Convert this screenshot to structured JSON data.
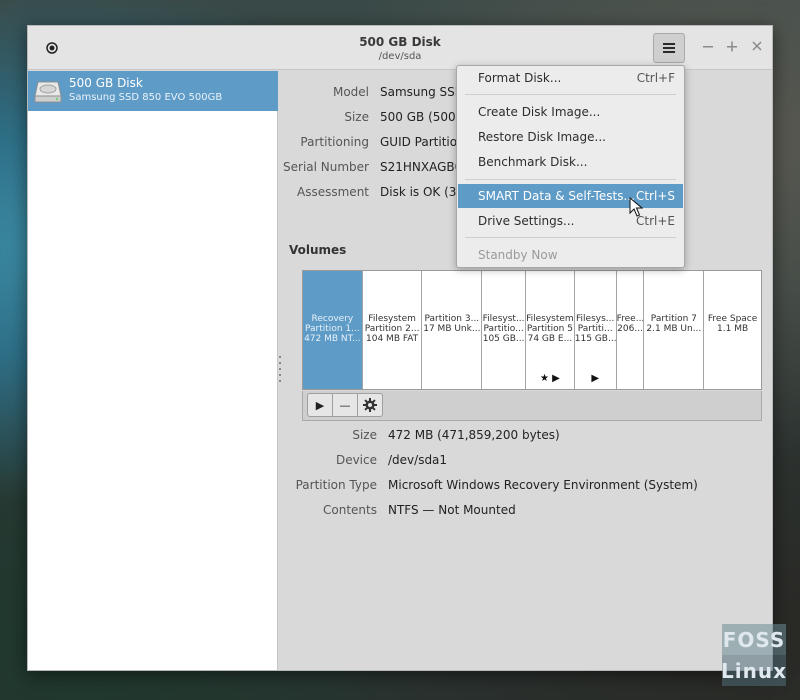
{
  "window": {
    "title": "500 GB Disk",
    "subtitle": "/dev/sda"
  },
  "sidebar": {
    "disk_name": "500 GB Disk",
    "disk_model": "Samsung SSD 850 EVO 500GB"
  },
  "drive": {
    "labels": [
      "Model",
      "Size",
      "Partitioning",
      "Serial Number",
      "Assessment"
    ],
    "values": [
      "Samsung SSD",
      "500 GB (500,1",
      "GUID Partition",
      "S21HNXAGB0",
      "Disk is OK (32"
    ]
  },
  "volumes": {
    "title": "Volumes",
    "segments": [
      {
        "line1": "Recovery",
        "line2": "Partition 1...",
        "line3": "472 MB NT...",
        "marks": ""
      },
      {
        "line1": "Filesystem",
        "line2": "Partition 2...",
        "line3": "104 MB FAT",
        "marks": ""
      },
      {
        "line1": "Partition 3...",
        "line2": "17 MB Unk...",
        "line3": "",
        "marks": ""
      },
      {
        "line1": "Filesyst...",
        "line2": "Partitio...",
        "line3": "105 GB...",
        "marks": ""
      },
      {
        "line1": "Filesystem",
        "line2": "Partition 5",
        "line3": "74 GB E...",
        "marks": "★ ▶"
      },
      {
        "line1": "Filesys...",
        "line2": "Partiti...",
        "line3": "115 GB...",
        "marks": "▶"
      },
      {
        "line1": "Free...",
        "line2": "206...",
        "line3": "",
        "marks": ""
      },
      {
        "line1": "Partition 7",
        "line2": "2.1 MB Un...",
        "line3": "",
        "marks": ""
      },
      {
        "line1": "Free Space",
        "line2": "1.1 MB",
        "line3": "",
        "marks": ""
      }
    ],
    "selected_index": 0
  },
  "toolbar": {
    "play_icon": "▶",
    "minus_icon": "—",
    "gear_icon": "gear"
  },
  "details": {
    "size_label": "Size",
    "size_value": "472 MB (471,859,200 bytes)",
    "device_label": "Device",
    "device_value": "/dev/sda1",
    "ptype_label": "Partition Type",
    "ptype_value": "Microsoft Windows Recovery Environment (System)",
    "contents_label": "Contents",
    "contents_value": "NTFS — Not Mounted"
  },
  "menu": {
    "items": [
      {
        "label": "Format Disk...",
        "accel": "Ctrl+F"
      },
      {
        "label": "Create Disk Image...",
        "accel": ""
      },
      {
        "label": "Restore Disk Image...",
        "accel": ""
      },
      {
        "label": "Benchmark Disk...",
        "accel": ""
      },
      {
        "label": "SMART Data & Self-Tests...",
        "accel": "Ctrl+S"
      },
      {
        "label": "Drive Settings...",
        "accel": "Ctrl+E"
      },
      {
        "label": "Standby Now",
        "accel": ""
      }
    ]
  },
  "watermark": {
    "line1": "FOSS",
    "line2": "Linux"
  },
  "colors": {
    "accent": "#5f9bc7",
    "window_bg": "#d9d9d9"
  }
}
